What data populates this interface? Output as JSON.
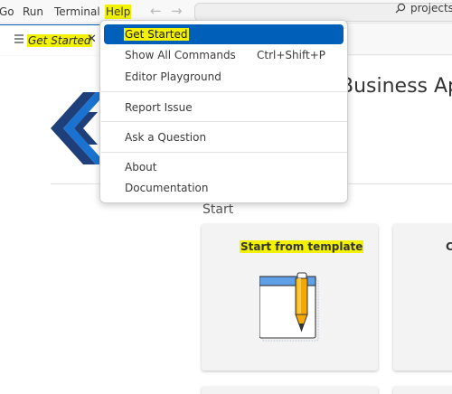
{
  "menubar": {
    "items": [
      "Go",
      "Run",
      "Terminal",
      "Help"
    ],
    "active_item": "Help"
  },
  "nav": {
    "back_icon": "arrow-left-icon",
    "forward_icon": "arrow-right-icon"
  },
  "command_center": {
    "icon": "search-icon",
    "text": "projects"
  },
  "tab": {
    "label": "Get Started",
    "close_glyph": "✕"
  },
  "welcome": {
    "heading": "Business App",
    "section_title": "Start",
    "card1_title": "Start from template",
    "card2_title": "C"
  },
  "help_menu": {
    "items": [
      {
        "label": "Get Started",
        "shortcut": ""
      },
      {
        "label": "Show All Commands",
        "shortcut": "Ctrl+Shift+P"
      },
      {
        "label": "Editor Playground",
        "shortcut": ""
      },
      {
        "label": "Report Issue",
        "shortcut": ""
      },
      {
        "label": "Ask a Question",
        "shortcut": ""
      },
      {
        "label": "About",
        "shortcut": ""
      },
      {
        "label": "Documentation",
        "shortcut": ""
      }
    ]
  },
  "colors": {
    "accent": "#005fb8",
    "highlight": "#f2f200",
    "logo_dark": "#1f3f7a",
    "logo_blue": "#1a73d1",
    "pencil": "#f5a800"
  }
}
